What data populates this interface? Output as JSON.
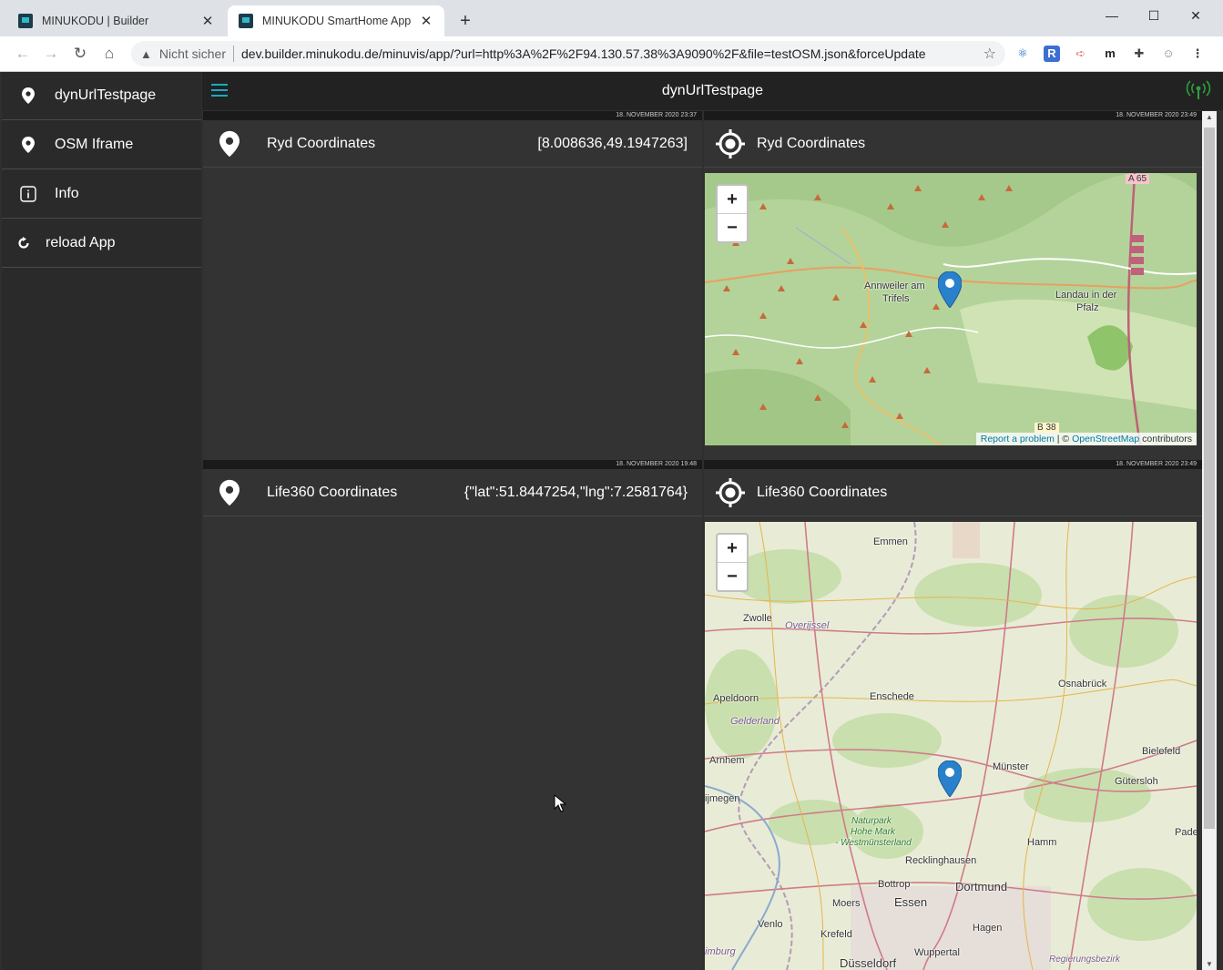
{
  "browser": {
    "tabs": [
      {
        "title": "MINUKODU | Builder",
        "active": false
      },
      {
        "title": "MINUKODU SmartHome App",
        "active": true
      }
    ],
    "security_label": "Nicht sicher",
    "url": "dev.builder.minukodu.de/minuvis/app/?url=http%3A%2F%2F94.130.57.38%3A9090%2F&file=testOSM.json&forceUpdate",
    "extensions": [
      {
        "icon": "react-icon",
        "glyph": "⚛",
        "color": "#1565c0"
      },
      {
        "icon": "r-extension-icon",
        "glyph": "R",
        "color": "#3b6fd4"
      },
      {
        "icon": "redirect-icon",
        "glyph": "➪",
        "color": "#e57373"
      },
      {
        "icon": "m-extension-icon",
        "glyph": "m",
        "color": "#222222"
      },
      {
        "icon": "puzzle-icon",
        "glyph": "✚",
        "color": "#444444"
      },
      {
        "icon": "profile-icon",
        "glyph": "☺",
        "color": "#888888"
      },
      {
        "icon": "menu-icon",
        "glyph": "⋮",
        "color": "#444444"
      }
    ]
  },
  "app": {
    "title": "dynUrlTestpage",
    "accent": "#1aa9c4",
    "status_color": "#2e9e3e"
  },
  "sidebar": {
    "items": [
      {
        "label": "dynUrlTestpage",
        "icon": "map-pin-icon"
      },
      {
        "label": "OSM Iframe",
        "icon": "map-pin-icon"
      },
      {
        "label": "Info",
        "icon": "info-icon"
      },
      {
        "label": "reload App",
        "icon": "reload-icon"
      }
    ]
  },
  "tiles": {
    "ryd_text": {
      "timestamp": "18. NOVEMBER 2020 23:37",
      "label": "Ryd Coordinates",
      "value": "[8.008636,49.1947263]"
    },
    "ryd_map": {
      "timestamp": "18. NOVEMBER 2020 23:49",
      "label": "Ryd Coordinates",
      "attribution_report": "Report a problem",
      "attribution_sep": " | © ",
      "attribution_osm": "OpenStreetMap",
      "attribution_tail": " contributors",
      "places": [
        "Annweiler am",
        "Trifels",
        "Landau in der",
        "Pfalz",
        "A 65",
        "B 38"
      ]
    },
    "life_text": {
      "timestamp": "18. NOVEMBER 2020 19:48",
      "label": "Life360 Coordinates",
      "value": "{\"lat\":51.8447254,\"lng\":7.2581764}"
    },
    "life_map": {
      "timestamp": "18. NOVEMBER 2020 23:49",
      "label": "Life360 Coordinates",
      "places": [
        "Emmen",
        "Zwolle",
        "Overijssel",
        "Apeldoorn",
        "Enschede",
        "Osnabrück",
        "Gelderland",
        "Arnhem",
        "Münster",
        "Bielefeld",
        "Gütersloh",
        "ijmegen",
        "Naturpark",
        "Hohe Mark",
        "- Westmünsterland",
        "Hamm",
        "Pade",
        "Recklinghausen",
        "Bottrop",
        "Dortmund",
        "Moers",
        "Essen",
        "Venlo",
        "Krefeld",
        "Hagen",
        "Wuppertal",
        "imburg",
        "Düsseldorf",
        "Regierungsbezirk"
      ]
    }
  }
}
